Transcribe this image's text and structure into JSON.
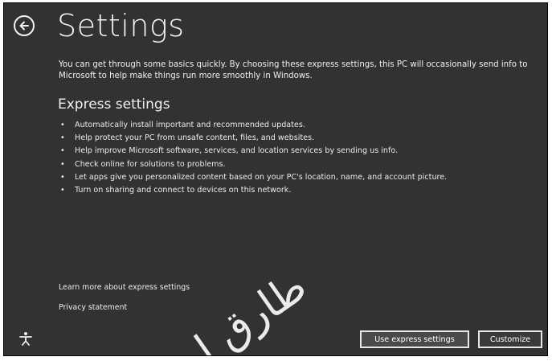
{
  "header": {
    "title": "Settings",
    "back_icon": "back-arrow-icon"
  },
  "intro_text": "You can get through some basics quickly. By choosing these express settings, this PC will occasionally send info to Microsoft to help make things run more smoothly in Windows.",
  "express": {
    "heading": "Express settings",
    "items": [
      "Automatically install important and recommended updates.",
      "Help protect your PC from unsafe content, files, and websites.",
      "Help improve Microsoft software, services, and location services by sending us info.",
      "Check online for solutions to problems.",
      "Let apps give you personalized content based on your PC's location, name, and account picture.",
      "Turn on sharing and connect to devices on this network."
    ]
  },
  "links": {
    "learn_more": "Learn more about express settings",
    "privacy": "Privacy statement"
  },
  "footer": {
    "ease_of_access_icon": "ease-of-access-icon",
    "use_express_label": "Use express settings",
    "customize_label": "Customize"
  },
  "watermark": {
    "text": "طارق ا"
  },
  "colors": {
    "background": "#323232",
    "text": "#f0f0f0",
    "button_border": "#e8e8e8"
  }
}
